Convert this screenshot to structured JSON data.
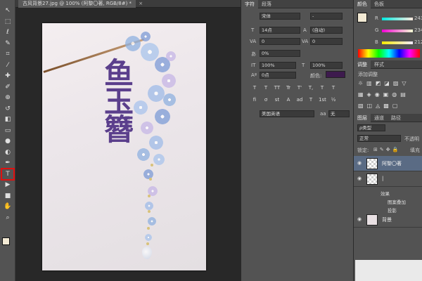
{
  "doc_tab": {
    "title": "古风背景27.jpg @ 100% (阿黎〇著, RGB/8#) *",
    "close": "×"
  },
  "toolbar": {
    "tools": [
      {
        "name": "move-icon",
        "glyph": "↖"
      },
      {
        "name": "marquee-icon",
        "glyph": "⬚"
      },
      {
        "name": "lasso-icon",
        "glyph": "ℓ"
      },
      {
        "name": "quick-select-icon",
        "glyph": "✎"
      },
      {
        "name": "crop-icon",
        "glyph": "⌗"
      },
      {
        "name": "eyedropper-icon",
        "glyph": "⁄"
      },
      {
        "name": "healing-icon",
        "glyph": "✚"
      },
      {
        "name": "brush-icon",
        "glyph": "✐"
      },
      {
        "name": "clone-icon",
        "glyph": "⊕"
      },
      {
        "name": "history-brush-icon",
        "glyph": "↺"
      },
      {
        "name": "eraser-icon",
        "glyph": "◧"
      },
      {
        "name": "gradient-icon",
        "glyph": "▭"
      },
      {
        "name": "blur-icon",
        "glyph": "●"
      },
      {
        "name": "dodge-icon",
        "glyph": "◐"
      },
      {
        "name": "pen-icon",
        "glyph": "✒"
      },
      {
        "name": "type-icon",
        "glyph": "T"
      },
      {
        "name": "path-select-icon",
        "glyph": "▶"
      },
      {
        "name": "shape-icon",
        "glyph": "■"
      },
      {
        "name": "hand-icon",
        "glyph": "✋"
      },
      {
        "name": "zoom-icon",
        "glyph": "⌕"
      }
    ],
    "active_tool": "type-icon"
  },
  "artwork": {
    "title": "鱼 玉 簪",
    "author": "阿黎〇著"
  },
  "character_panel": {
    "tabs": [
      "字符",
      "段落"
    ],
    "font_family": "宋体",
    "font_style": "-",
    "font_size": "14点",
    "leading": "(自动)",
    "kerning": "0",
    "tracking": "0",
    "tsume": "0%",
    "vertical_scale": "100%",
    "horizontal_scale": "100%",
    "baseline_shift": "0点",
    "color_label": "颜色:",
    "text_color": "#3d1a4d",
    "style_buttons": [
      "T",
      "T",
      "TT",
      "Tr",
      "T'",
      "T,",
      "T",
      "T"
    ],
    "extra_buttons": [
      "fi",
      "ơ",
      "st",
      "A",
      "ad",
      "T",
      "1st",
      "½"
    ],
    "language": "美国英语",
    "antialias_icon": "aa",
    "antialias": "无"
  },
  "color_panel": {
    "tabs": [
      "颜色",
      "色板"
    ],
    "r_label": "R",
    "g_label": "G",
    "b_label": "B",
    "r": "243",
    "g": "234",
    "b": "212"
  },
  "adjust_panel": {
    "tabs": [
      "调整",
      "样式"
    ],
    "title": "添加调整"
  },
  "layers_panel": {
    "tabs": [
      "图层",
      "通道",
      "路径"
    ],
    "kind": "ρ类型",
    "blend": "正常",
    "opacity_label": "不透明",
    "lock_label": "锁定:",
    "fill_label": "填充",
    "layers": [
      {
        "name": "阿黎〇著",
        "selected": true
      },
      {
        "name": "|",
        "selected": false
      },
      {
        "name": "背景",
        "selected": false
      }
    ],
    "effects": [
      "效果",
      "图案叠加",
      "投影"
    ]
  }
}
